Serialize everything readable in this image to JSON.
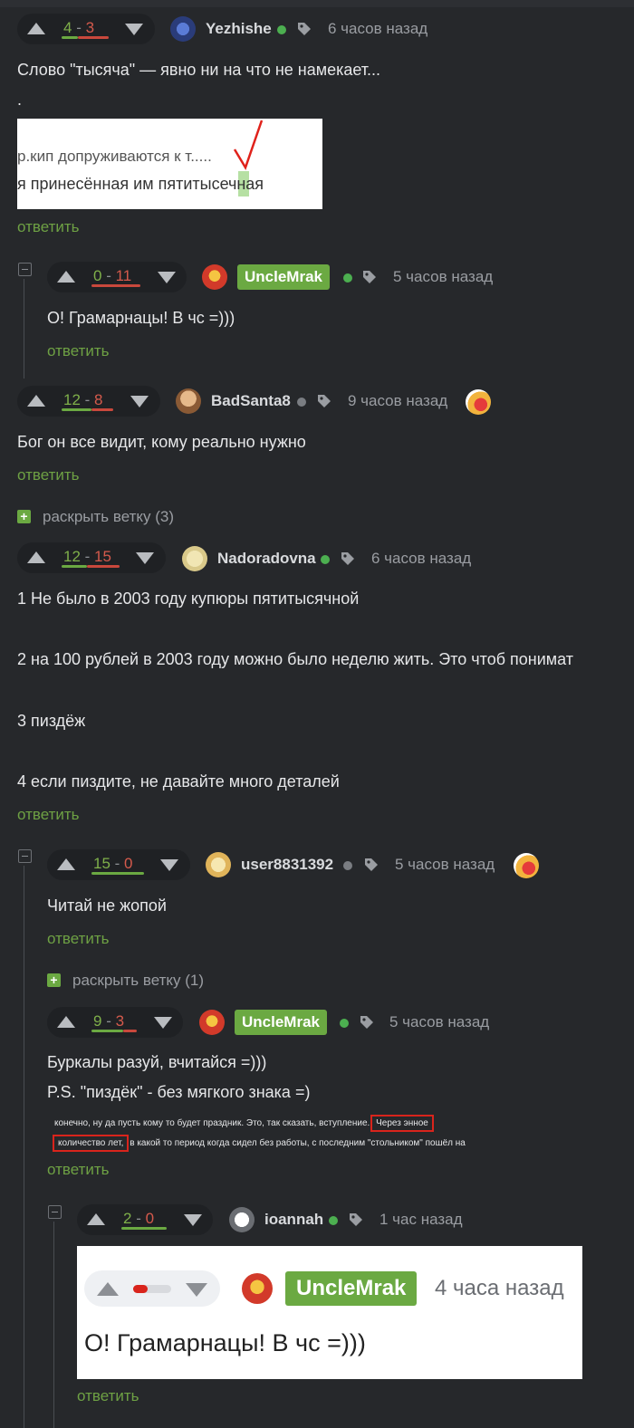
{
  "colors": {
    "background": "#26282b",
    "accent_green": "#6ba942",
    "plus": "#7fb04a",
    "minus": "#d55a4c",
    "online": "#4caf50",
    "offline": "#7a7d82"
  },
  "icons": {
    "vote_up": "triangle-up-icon",
    "vote_down": "triangle-down-icon",
    "tag": "tag-icon",
    "collapse": "collapse-square-icon",
    "expand": "plus-square-icon"
  },
  "reply_label": "ответить",
  "comments": [
    {
      "rating_plus": "4",
      "rating_minus": "3",
      "author": "Yezhishe",
      "online": true,
      "time": "6 часов назад",
      "lines": [
        "Слово \"тысяча\" — явно ни на что не намекает...",
        "."
      ],
      "image": {
        "line1": "р.кип  допруживаются к т.....",
        "line2": "я принесённая им пятитысечная"
      }
    },
    {
      "rating_plus": "0",
      "rating_minus": "11",
      "author": "UncleMrak",
      "online": true,
      "time": "5 часов назад",
      "lines": [
        "О! Грамарнацы! В чс =)))"
      ]
    },
    {
      "rating_plus": "12",
      "rating_minus": "8",
      "author": "BadSanta8",
      "online": false,
      "time": "9 часов назад",
      "lines": [
        "Бог он все видит, кому реально нужно"
      ],
      "expand": "раскрыть ветку (3)"
    },
    {
      "rating_plus": "12",
      "rating_minus": "15",
      "author": "Nadoradovna",
      "online": true,
      "time": "6 часов назад",
      "lines": [
        "1 Не было в 2003 году купюры пятитысячной",
        "2 на 100 рублей в 2003 году можно было неделю жить. Это чтоб понимат",
        "3 пиздёж",
        "4 если пиздите, не давайте много деталей"
      ]
    },
    {
      "rating_plus": "15",
      "rating_minus": "0",
      "author": "user8831392",
      "online": false,
      "time": "5 часов назад",
      "lines": [
        "Читай не жопой"
      ],
      "expand": "раскрыть ветку (1)"
    },
    {
      "rating_plus": "9",
      "rating_minus": "3",
      "author": "UncleMrak",
      "online": true,
      "time": "5 часов назад",
      "lines": [
        "Буркалы разуй, вчитайся =)))",
        "P.S. \"пиздёк\" - без мягкого знака =)"
      ],
      "image": {
        "line1a": "конечно, ну да пусть кому то будет праздник. Это, так сказать, вступление.",
        "line1b": "Через энное",
        "line2a": "количество лет,",
        "line2b": "в какой то период когда сидел без работы, с последним \"стольником\" пошёл на"
      }
    },
    {
      "rating_plus": "2",
      "rating_minus": "0",
      "author": "ioannah",
      "online": true,
      "time": "1 час назад",
      "image": {
        "author": "UncleMrak",
        "time": "4 часа назад",
        "text": "О! Грамарнацы! В чс =)))"
      }
    }
  ]
}
